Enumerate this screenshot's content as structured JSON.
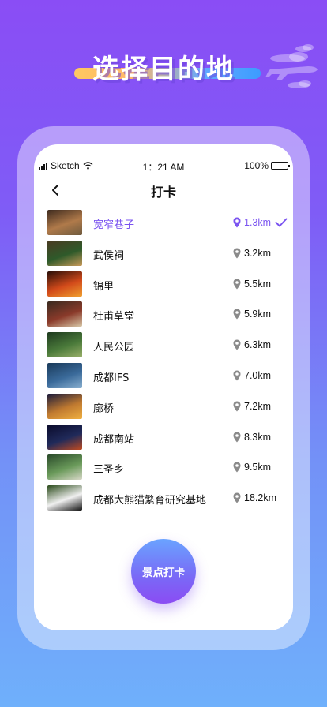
{
  "headline": "选择目的地",
  "status": {
    "carrier": "Sketch",
    "time": "1：21 AM",
    "battery": "100%",
    "battery_level": 1.0
  },
  "nav": {
    "title": "打卡"
  },
  "places": [
    {
      "name": "宽窄巷子",
      "distance": "1.3km",
      "selected": true,
      "colors": [
        "#3d2a1e",
        "#b07a4a",
        "#6e5a3e"
      ]
    },
    {
      "name": "武侯祠",
      "distance": "3.2km",
      "selected": false,
      "colors": [
        "#4b3a22",
        "#2e5a2a",
        "#c99a5a"
      ]
    },
    {
      "name": "锦里",
      "distance": "5.5km",
      "selected": false,
      "colors": [
        "#2a0f08",
        "#d24a1a",
        "#f0a030"
      ]
    },
    {
      "name": "杜甫草堂",
      "distance": "5.9km",
      "selected": false,
      "colors": [
        "#3a2a20",
        "#8a3a2a",
        "#d8c8a8"
      ]
    },
    {
      "name": "人民公园",
      "distance": "6.3km",
      "selected": false,
      "colors": [
        "#1e3a1e",
        "#4a7a3a",
        "#9ab06a"
      ]
    },
    {
      "name": "成都IFS",
      "distance": "7.0km",
      "selected": false,
      "colors": [
        "#1a3a5a",
        "#3a6a9a",
        "#8ab0d0"
      ]
    },
    {
      "name": "廊桥",
      "distance": "7.2km",
      "selected": false,
      "colors": [
        "#1a1a3a",
        "#c07a30",
        "#f0b040"
      ]
    },
    {
      "name": "成都南站",
      "distance": "8.3km",
      "selected": false,
      "colors": [
        "#0a0a2a",
        "#202a5a",
        "#c04a20"
      ]
    },
    {
      "name": "三圣乡",
      "distance": "9.5km",
      "selected": false,
      "colors": [
        "#2a4a2a",
        "#6a9a5a",
        "#d8d8c8"
      ]
    },
    {
      "name": "成都大熊猫繁育研究基地",
      "distance": "18.2km",
      "selected": false,
      "colors": [
        "#2a4a1a",
        "#f0f0f0",
        "#111111"
      ]
    }
  ],
  "cta": {
    "label": "景点打卡"
  },
  "colors": {
    "accent": "#7b54f0",
    "pin_gray": "#8a8a8a"
  },
  "icons": {
    "back": "chevron-left-icon",
    "pin": "location-pin-icon",
    "check": "checkmark-icon",
    "plane": "airplane-icon"
  }
}
